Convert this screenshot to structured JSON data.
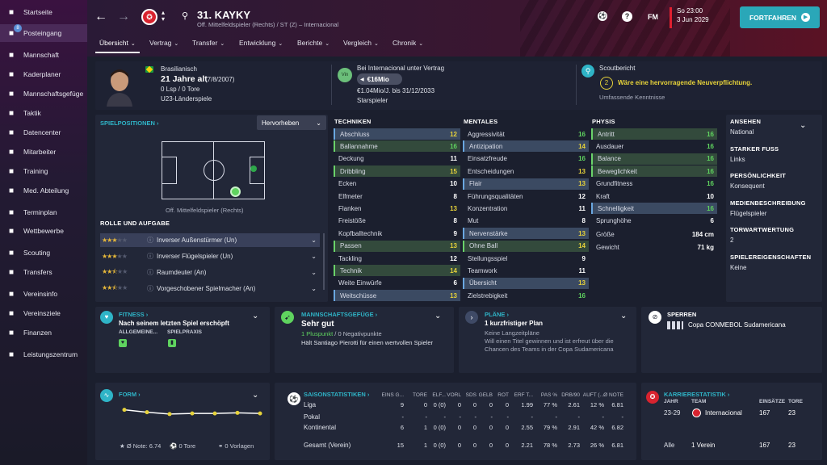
{
  "sidebar": {
    "items": [
      {
        "icon": "home-icon",
        "label": "Startseite"
      },
      {
        "icon": "inbox-icon",
        "label": "Posteingang",
        "badge": "8"
      },
      {
        "icon": "shirt-icon",
        "label": "Mannschaft"
      },
      {
        "icon": "planner-icon",
        "label": "Kaderplaner"
      },
      {
        "icon": "dynamics-icon",
        "label": "Mannschaftsgefüge"
      },
      {
        "icon": "tactics-icon",
        "label": "Taktik"
      },
      {
        "icon": "data-icon",
        "label": "Datencenter"
      },
      {
        "icon": "staff-icon",
        "label": "Mitarbeiter"
      },
      {
        "icon": "training-icon",
        "label": "Training"
      },
      {
        "icon": "medical-icon",
        "label": "Med. Abteilung"
      },
      {
        "icon": "calendar-icon",
        "label": "Terminplan"
      },
      {
        "icon": "trophy-icon",
        "label": "Wettbewerbe"
      },
      {
        "icon": "scouting-icon",
        "label": "Scouting"
      },
      {
        "icon": "transfer-icon",
        "label": "Transfers"
      },
      {
        "icon": "club-icon",
        "label": "Vereinsinfo"
      },
      {
        "icon": "goals-icon",
        "label": "Vereinsziele"
      },
      {
        "icon": "finance-icon",
        "label": "Finanzen"
      },
      {
        "icon": "dev-icon",
        "label": "Leistungszentrum"
      }
    ]
  },
  "header": {
    "player_name": "31. KAYKY",
    "player_sub": "Off. Mittelfeldspieler (Rechts) / ST (Z) – Internacional",
    "date_day": "So 23:00",
    "date_date": "3 Jun 2029",
    "continue_label": "FORTFAHREN",
    "fm_label": "FM"
  },
  "tabs": [
    "Übersicht",
    "Vertrag",
    "Transfer",
    "Entwicklung",
    "Berichte",
    "Vergleich",
    "Chronik"
  ],
  "bio": {
    "nationality": "Brasilianisch",
    "age": "21 Jahre alt",
    "dob": "(7/8/2007)",
    "caps": "0 Lsp / 0 Tore",
    "youth": "U23-Länderspiele"
  },
  "contract": {
    "badge": "Vin",
    "line1": "Bei Internacional unter Vertrag",
    "value": "€16Mio",
    "wage": "€1.04Mio/J. bis 31/12/2033",
    "status": "Starspieler"
  },
  "scout": {
    "title": "Scoutbericht",
    "num": "2",
    "text": "Wäre eine hervorragende Neuverpflichtung.",
    "knowledge": "Umfassende Kenntnisse"
  },
  "positions": {
    "title": "SPIELPOSITIONEN",
    "highlight": "Hervorheben",
    "pos_label": "Off. Mittelfeldspieler (Rechts)"
  },
  "roles": {
    "title": "ROLLE UND AUFGABE",
    "items": [
      {
        "name": "Inverser Außenstürmer (Un)",
        "stars": 3,
        "half": false
      },
      {
        "name": "Inverser Flügelspieler (Un)",
        "stars": 3,
        "half": false
      },
      {
        "name": "Raumdeuter (An)",
        "stars": 2,
        "half": true
      },
      {
        "name": "Vorgeschobener Spielmacher (An)",
        "stars": 2,
        "half": true
      }
    ]
  },
  "techniken": {
    "title": "TECHNIKEN",
    "items": [
      {
        "n": "Abschluss",
        "v": "12",
        "c": "y",
        "h": "hl"
      },
      {
        "n": "Ballannahme",
        "v": "16",
        "c": "g",
        "h": "hlg"
      },
      {
        "n": "Deckung",
        "v": "11",
        "c": "w",
        "h": ""
      },
      {
        "n": "Dribbling",
        "v": "15",
        "c": "y",
        "h": "hlg"
      },
      {
        "n": "Ecken",
        "v": "10",
        "c": "w",
        "h": ""
      },
      {
        "n": "Elfmeter",
        "v": "8",
        "c": "w",
        "h": ""
      },
      {
        "n": "Flanken",
        "v": "13",
        "c": "y",
        "h": ""
      },
      {
        "n": "Freistöße",
        "v": "8",
        "c": "w",
        "h": ""
      },
      {
        "n": "Kopfballtechnik",
        "v": "9",
        "c": "w",
        "h": ""
      },
      {
        "n": "Passen",
        "v": "13",
        "c": "y",
        "h": "hlg"
      },
      {
        "n": "Tackling",
        "v": "12",
        "c": "w",
        "h": ""
      },
      {
        "n": "Technik",
        "v": "14",
        "c": "y",
        "h": "hlg"
      },
      {
        "n": "Weite Einwürfe",
        "v": "6",
        "c": "w",
        "h": ""
      },
      {
        "n": "Weitschüsse",
        "v": "13",
        "c": "y",
        "h": "hl"
      }
    ]
  },
  "mentales": {
    "title": "MENTALES",
    "items": [
      {
        "n": "Aggressivität",
        "v": "16",
        "c": "g",
        "h": ""
      },
      {
        "n": "Antizipation",
        "v": "14",
        "c": "y",
        "h": "hl"
      },
      {
        "n": "Einsatzfreude",
        "v": "16",
        "c": "g",
        "h": ""
      },
      {
        "n": "Entscheidungen",
        "v": "13",
        "c": "y",
        "h": ""
      },
      {
        "n": "Flair",
        "v": "13",
        "c": "y",
        "h": "hl"
      },
      {
        "n": "Führungsqualitäten",
        "v": "12",
        "c": "w",
        "h": ""
      },
      {
        "n": "Konzentration",
        "v": "11",
        "c": "w",
        "h": ""
      },
      {
        "n": "Mut",
        "v": "8",
        "c": "w",
        "h": ""
      },
      {
        "n": "Nervenstärke",
        "v": "13",
        "c": "y",
        "h": "hl"
      },
      {
        "n": "Ohne Ball",
        "v": "14",
        "c": "y",
        "h": "hlg"
      },
      {
        "n": "Stellungsspiel",
        "v": "9",
        "c": "w",
        "h": ""
      },
      {
        "n": "Teamwork",
        "v": "11",
        "c": "w",
        "h": ""
      },
      {
        "n": "Übersicht",
        "v": "13",
        "c": "y",
        "h": "hl"
      },
      {
        "n": "Zielstrebigkeit",
        "v": "16",
        "c": "g",
        "h": ""
      }
    ]
  },
  "physis": {
    "title": "PHYSIS",
    "items": [
      {
        "n": "Antritt",
        "v": "16",
        "c": "g",
        "h": "hlg"
      },
      {
        "n": "Ausdauer",
        "v": "16",
        "c": "g",
        "h": ""
      },
      {
        "n": "Balance",
        "v": "16",
        "c": "g",
        "h": "hlg"
      },
      {
        "n": "Beweglichkeit",
        "v": "16",
        "c": "g",
        "h": "hlg"
      },
      {
        "n": "Grundfitness",
        "v": "16",
        "c": "g",
        "h": ""
      },
      {
        "n": "Kraft",
        "v": "10",
        "c": "w",
        "h": ""
      },
      {
        "n": "Schnelligkeit",
        "v": "16",
        "c": "g",
        "h": "hl"
      },
      {
        "n": "Sprunghöhe",
        "v": "6",
        "c": "w",
        "h": ""
      }
    ],
    "size": [
      {
        "n": "Größe",
        "v": "184 cm"
      },
      {
        "n": "Gewicht",
        "v": "71 kg"
      }
    ]
  },
  "info": [
    {
      "h": "ANSEHEN",
      "v": "National"
    },
    {
      "h": "STARKER FUSS",
      "v": "Links"
    },
    {
      "h": "PERSÖNLICHKEIT",
      "v": "Konsequent"
    },
    {
      "h": "MEDIENBESCHREIBUNG",
      "v": "Flügelspieler"
    },
    {
      "h": "TORWARTWERTUNG",
      "v": "2"
    },
    {
      "h": "SPIELEREIGENSCHAFTEN",
      "v": "Keine"
    }
  ],
  "fitness": {
    "title": "FITNESS",
    "text": "Nach seinem letzten Spiel erschöpft",
    "l1": "ALLGEMEINE...",
    "l2": "SPIELPRAXIS"
  },
  "morale": {
    "title": "MANNSCHAFTSGEFÜGE",
    "value": "Sehr gut",
    "pos": "1 Pluspunkt",
    "sep": " / ",
    "neg": "0 Negativpunkte",
    "text": "Hält Santiago Pierotti für einen wertvollen Spieler"
  },
  "plans": {
    "title": "PLÄNE",
    "value": "1 kurzfristiger Plan",
    "l2": "Keine Langzeitpläne",
    "text": "Will einen Titel gewinnen und ist erfreut über die Chancen des Teams in der Copa Sudamericana"
  },
  "bans": {
    "title": "SPERREN",
    "comp": "Copa CONMEBOL Sudamericana"
  },
  "form": {
    "title": "FORM",
    "values": [
      0.8,
      0.72,
      0.66,
      0.68,
      0.68,
      0.7,
      0.68
    ],
    "note": "Ø Note: 6.74",
    "goals": "0 Tore",
    "assists": "0 Vorlagen"
  },
  "season": {
    "title": "SAISONSTATISTIKEN",
    "headers": [
      "EINS G...",
      "TORE",
      "ELF...",
      "VORL",
      "SDS",
      "GELB",
      "ROT",
      "ERF T...",
      "PAS %",
      "DRB/90",
      "AUFT (...",
      "Ø NOTE"
    ],
    "rows": [
      {
        "name": "Liga",
        "vals": [
          "9",
          "0",
          "0 (0)",
          "0",
          "0",
          "0",
          "0",
          "1.99",
          "77 %",
          "2.61",
          "12 %",
          "6.81"
        ]
      },
      {
        "name": "Pokal",
        "vals": [
          "-",
          "-",
          "-",
          "-",
          "-",
          "-",
          "-",
          "-",
          "-",
          "-",
          "-",
          "-"
        ]
      },
      {
        "name": "Kontinental",
        "vals": [
          "6",
          "1",
          "0 (0)",
          "0",
          "0",
          "0",
          "0",
          "2.55",
          "79 %",
          "2.91",
          "42 %",
          "6.82"
        ]
      },
      {
        "name": "Gesamt (Verein)",
        "vals": [
          "15",
          "1",
          "0 (0)",
          "0",
          "0",
          "0",
          "0",
          "2.21",
          "78 %",
          "2.73",
          "26 %",
          "6.81"
        ]
      }
    ]
  },
  "career": {
    "title": "KARRIERESTATISTIK",
    "headers": [
      "JAHR",
      "TEAM",
      "EINSÄTZE",
      "TORE"
    ],
    "rows": [
      {
        "year": "23-29",
        "team": "Internacional",
        "apps": "167",
        "goals": "23"
      },
      {
        "year": "Alle",
        "team": "1 Verein",
        "apps": "167",
        "goals": "23"
      }
    ]
  },
  "colors": {
    "accent": "#2fb4c7",
    "green": "#5fd35f",
    "yellow": "#e6d23a",
    "brand_red": "#d8232f"
  }
}
